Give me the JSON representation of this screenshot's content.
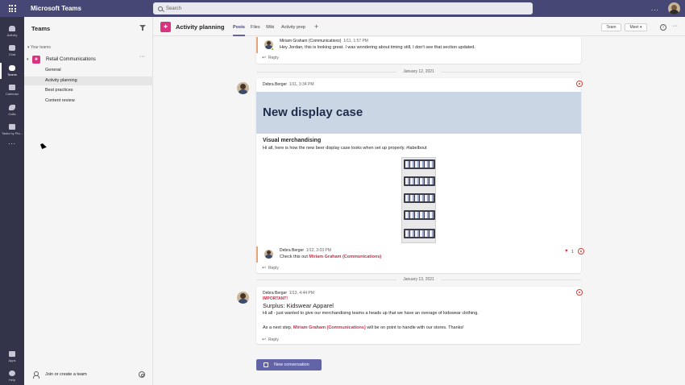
{
  "titlebar": {
    "app_title": "Microsoft Teams",
    "search_placeholder": "Search",
    "more": "..."
  },
  "rail": {
    "items": [
      {
        "label": "Activity",
        "icon": "bell-icon"
      },
      {
        "label": "Chat",
        "icon": "chat-icon"
      },
      {
        "label": "Teams",
        "icon": "teams-icon",
        "active": true
      },
      {
        "label": "Calendar",
        "icon": "calendar-icon"
      },
      {
        "label": "Calls",
        "icon": "phone-icon"
      },
      {
        "label": "Tasks by Pla...",
        "icon": "tasks-icon"
      }
    ],
    "more": "...",
    "bottom": [
      {
        "label": "Apps",
        "icon": "apps-icon"
      },
      {
        "label": "Help",
        "icon": "help-icon"
      }
    ]
  },
  "panel": {
    "title": "Teams",
    "section": "Your teams",
    "team": {
      "name": "Retail Communications",
      "more": "···"
    },
    "channels": [
      "General",
      "Activity planning",
      "Best practices",
      "Content review"
    ],
    "join": "Join or create a team"
  },
  "header": {
    "channel_title": "Activity planning",
    "tabs": [
      "Posts",
      "Files",
      "Wiki",
      "Activity prep"
    ],
    "add_tab": "+",
    "team_button": "Team",
    "meet_button": "Meet",
    "info": "i",
    "more": "···"
  },
  "feed": {
    "reply_label": "Reply",
    "top_reply": {
      "author": "Miriam Graham (Communications)",
      "time": "1/11, 1:57 PM",
      "text": "Hey Jordan, this is looking great. I was wondering about timing still, I don't see that section updated."
    },
    "dates": [
      "January 12, 2021",
      "January 13, 2021"
    ],
    "post1": {
      "author": "Debra Berger",
      "time": "1/11, 3:34 PM",
      "banner_title": "New display case",
      "subheading": "Visual merchandising",
      "text": "Hi all, here is how the new beer display case looks when set up properly. #labelbout",
      "reply": {
        "author": "Debra Berger",
        "time": "1/12, 3:03 PM",
        "text_prefix": "Check this out",
        "mention": "Miriam Graham (Communications)",
        "heart_count": "1"
      }
    },
    "post2": {
      "author": "Debra Berger",
      "time": "1/13, 4:44 PM",
      "important": "IMPORTANT!",
      "subheading": "Surplus: Kidswear Apparel",
      "text1": "Hi all - just wanted to give our merchandising teams a heads up that we have an overage of kidswear clothing.",
      "text2_prefix": "As a next step,",
      "mention": "Miriam Graham (Communications)",
      "text2_suffix": "will be on point to handle with our stores. Thanks!"
    },
    "new_conversation": "New conversation"
  },
  "colors": {
    "titlebar": "#464775",
    "rail": "#33344a",
    "accent": "#6264a7",
    "team_avatar": "#d9347f",
    "mention": "#c4314b",
    "banner": "#cbd6e4"
  }
}
